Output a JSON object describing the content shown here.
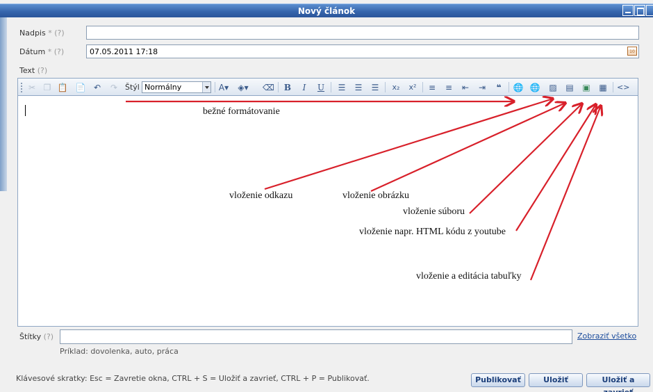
{
  "window": {
    "title": "Nový článok"
  },
  "form": {
    "nadpis": {
      "label": "Nadpis",
      "required": "*",
      "help": "(?)",
      "value": ""
    },
    "datum": {
      "label": "Dátum",
      "required": "*",
      "help": "(?)",
      "value": "07.05.2011 17:18",
      "calendar_text": "10"
    },
    "text": {
      "label": "Text",
      "help": "(?)"
    }
  },
  "toolbar": {
    "style_label": "Štýl",
    "style_value": "Normálny",
    "icons": [
      "cut-icon",
      "copy-icon",
      "paste-icon",
      "paste-word-icon",
      "undo-icon",
      "redo-icon",
      "font-color-icon",
      "bg-color-icon",
      "remove-format-icon",
      "bold-icon",
      "italic-icon",
      "underline-icon",
      "align-left-icon",
      "align-center-icon",
      "align-right-icon",
      "subscript-icon",
      "superscript-icon",
      "numbered-list-icon",
      "bulleted-list-icon",
      "outdent-icon",
      "indent-icon",
      "blockquote-icon",
      "link-icon",
      "unlink-icon",
      "image-icon",
      "file-icon",
      "media-icon",
      "table-icon",
      "source-icon"
    ]
  },
  "annotations": {
    "formatting": "bežné formátovanie",
    "link": "vloženie odkazu",
    "image": "vloženie obrázku",
    "file": "vloženie súboru",
    "html": "vloženie napr. HTML kódu z youtube",
    "table": "vloženie a editácia tabuľky",
    "arrow_color": "#d8202a"
  },
  "tags": {
    "label": "Štítky",
    "help": "(?)",
    "show_all": "Zobraziť všetko",
    "example": "Príklad: dovolenka, auto, práca"
  },
  "footer": {
    "shortcuts": "Klávesové skratky: Esc = Zavretie okna, CTRL + S = Uložiť a zavrieť, CTRL + P = Publikovať.",
    "publish": "Publikovať",
    "save": "Uložiť",
    "save_close": "Uložiť a zavrieť"
  }
}
